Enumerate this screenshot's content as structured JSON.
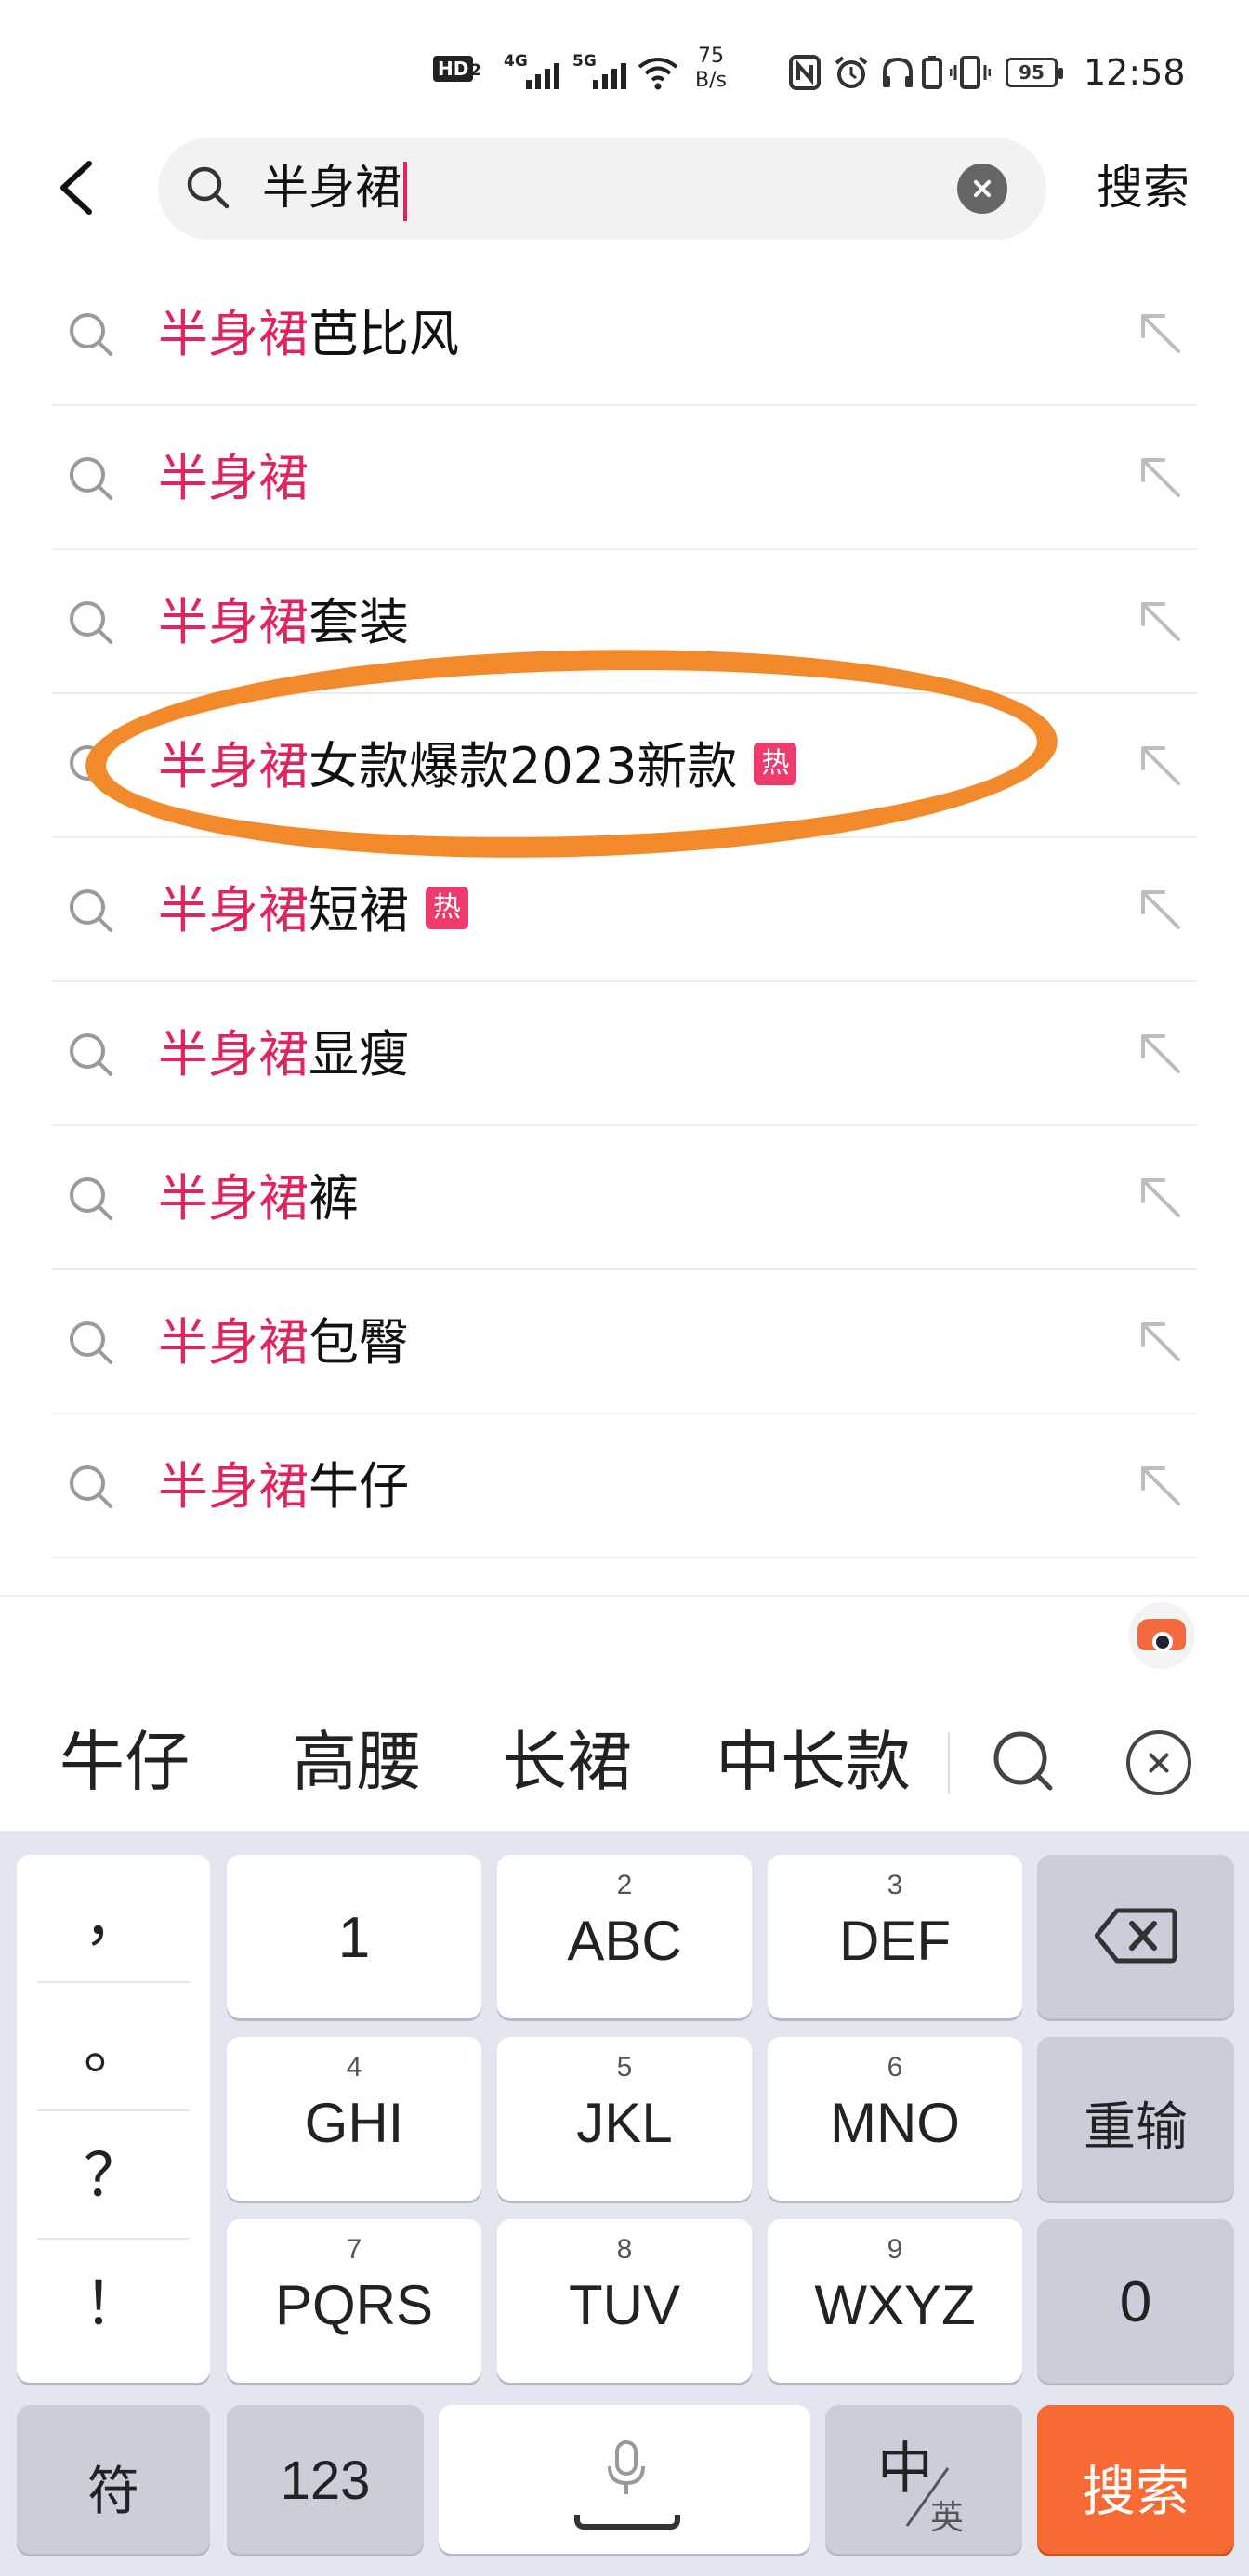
{
  "status_bar": {
    "hd": "HD",
    "sim": "2",
    "net1": "4G",
    "net2": "5G",
    "speed_value": "75",
    "speed_unit": "B/s",
    "battery": "95",
    "time": "12:58"
  },
  "header": {
    "search_value": "半身裙",
    "search_button": "搜索"
  },
  "suggestions": [
    {
      "highlight": "半身裙",
      "rest": "芭比风",
      "hot": false
    },
    {
      "highlight": "半身裙",
      "rest": "",
      "hot": false
    },
    {
      "highlight": "半身裙",
      "rest": "套装",
      "hot": false
    },
    {
      "highlight": "半身裙",
      "rest": "女款爆款2023新款",
      "hot": true
    },
    {
      "highlight": "半身裙",
      "rest": "短裙",
      "hot": true
    },
    {
      "highlight": "半身裙",
      "rest": "显瘦",
      "hot": false
    },
    {
      "highlight": "半身裙",
      "rest": "裤",
      "hot": false
    },
    {
      "highlight": "半身裙",
      "rest": "包臀",
      "hot": false
    },
    {
      "highlight": "半身裙",
      "rest": "牛仔",
      "hot": false
    }
  ],
  "hot_badge": "热",
  "candidates": [
    "牛仔",
    "高腰",
    "长裙",
    "中长款"
  ],
  "keyboard": {
    "punctuation": [
      "，",
      "。",
      "？",
      "！"
    ],
    "row1": [
      {
        "sub": "",
        "main": "1"
      },
      {
        "sub": "2",
        "main": "ABC"
      },
      {
        "sub": "3",
        "main": "DEF"
      }
    ],
    "row2": [
      {
        "sub": "4",
        "main": "GHI"
      },
      {
        "sub": "5",
        "main": "JKL"
      },
      {
        "sub": "6",
        "main": "MNO"
      }
    ],
    "row3": [
      {
        "sub": "7",
        "main": "PQRS"
      },
      {
        "sub": "8",
        "main": "TUV"
      },
      {
        "sub": "9",
        "main": "WXYZ"
      }
    ],
    "retype": "重输",
    "zero": "0",
    "symbols": "符",
    "num_switch": "123",
    "lang_main": "中",
    "lang_sub": "英",
    "search": "搜索"
  },
  "colors": {
    "highlight": "#e0245e",
    "accent_orange": "#f86a33",
    "circle_mark": "#f28a2c"
  }
}
